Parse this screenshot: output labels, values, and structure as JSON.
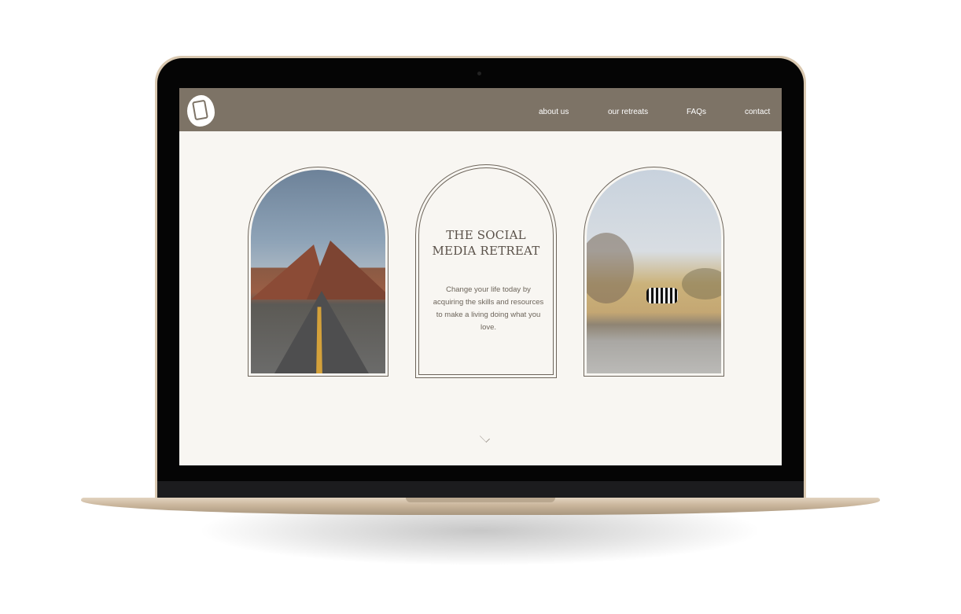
{
  "nav": {
    "items": [
      {
        "label": "about us"
      },
      {
        "label": "our retreats"
      },
      {
        "label": "FAQs"
      },
      {
        "label": "contact"
      }
    ]
  },
  "hero": {
    "title_line1": "THE SOCIAL",
    "title_line2": "MEDIA RETREAT",
    "description": "Change your life today by acquiring the skills and resources to make a living doing what you love."
  },
  "images": {
    "left": "desert-road-photo",
    "right": "zebra-savanna-photo"
  },
  "icons": {
    "logo": "phone-logo-icon",
    "scroll": "chevron-down-icon"
  },
  "colors": {
    "navbar": "#7d7366",
    "page_bg": "#f8f6f2",
    "text": "#5a5149",
    "laptop_frame": "#d9c8b0"
  }
}
